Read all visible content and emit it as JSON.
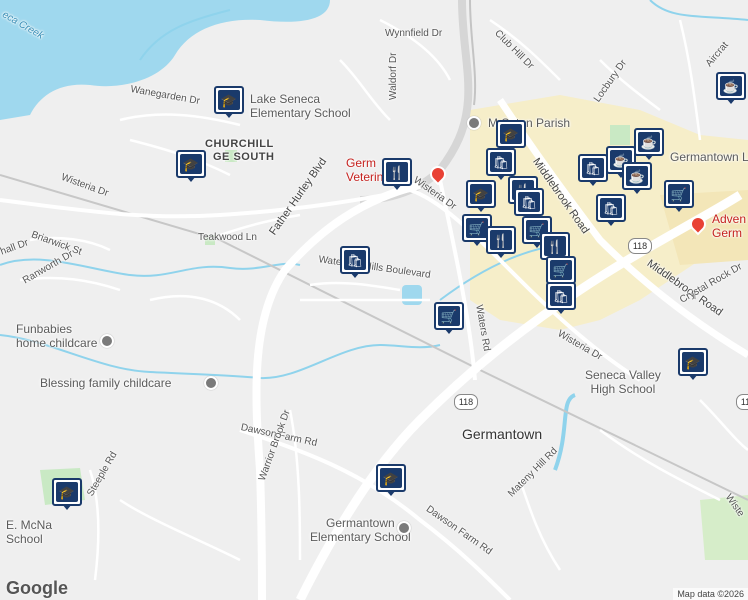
{
  "map": {
    "colors": {
      "water": "#9fd8ee",
      "stream": "#8fd3ec",
      "major_road": "#ffffff",
      "highway": "#d6d6d6",
      "commercial": "#f6eec9",
      "park": "#c9e9c4",
      "pin": "#1a3a6b"
    },
    "attribution": "Map data ©2026",
    "logo": "Google",
    "places": {
      "churchill": "CHURCHILL",
      "village_south": "GE SOUTH",
      "germantown": "Germantown",
      "lake_seneca": "Lake Seneca",
      "lake_seneca_es": "Elementary School",
      "funbabies": "Funbabies",
      "funbabies_2": "home childcare",
      "blessing": "Blessing family childcare",
      "mother_seton": "M        Seton Parish",
      "germ_vet_1": "Germ",
      "germ_vet_2": "Veterinar",
      "seneca_valley_1": "Seneca Valley",
      "seneca_valley_2": "High School",
      "germantown_es_1": "Germantown",
      "germantown_es_2": "Elementary School",
      "mcnair_1": "E. McNa",
      "mcnair_2": "School",
      "germantown_li": "Germantown Li",
      "adven_1": "Adven",
      "adven_2": "Germ",
      "seneca_creek": "eca Creek"
    },
    "roads": {
      "wynnfield": "Wynnfield Dr",
      "club_hill": "Club Hill Dr",
      "locbury": "Locbury Dr",
      "wanegarden": "Wanegarden Dr",
      "waldorf": "Waldorf Dr",
      "wisteria_w": "Wisteria Dr",
      "wisteria_c": "Wisteria Dr",
      "wisteria_e": "Wisteria Dr",
      "wisteria_far": "Wiste",
      "teakwood": "Teakwood Ln",
      "father_hurley": "Father Hurley Blvd",
      "briarwick": "Briarwick St",
      "shall": "hall Dr",
      "ranworth": "Ranworth Dr",
      "waterford": "Waterford Hills Boulevard",
      "waters": "Waters Rd",
      "middlebrook_1": "Middlebrook Road",
      "middlebrook_2": "Middlebrook Road",
      "crystal_rock": "Crystal Rock Dr",
      "dawson_1": "Dawson Farm Rd",
      "dawson_2": "Dawson Farm Rd",
      "warrior_brook": "Warrior Brook Dr",
      "steeple": "Steeple Rd",
      "mateny": "Mateny Hill Rd",
      "aircraft": "Aircrat",
      "route_118_a": "118",
      "route_118_b": "118",
      "route_118_c": "118"
    },
    "icons": {
      "school": "school-icon",
      "cafe": "cafe-icon",
      "restaurant": "restaurant-icon",
      "shopping": "shopping-bag-icon",
      "grocery": "shopping-cart-icon",
      "church": "church-icon",
      "childcare": "place-pin-icon",
      "vet": "red-place-pin-icon"
    }
  }
}
